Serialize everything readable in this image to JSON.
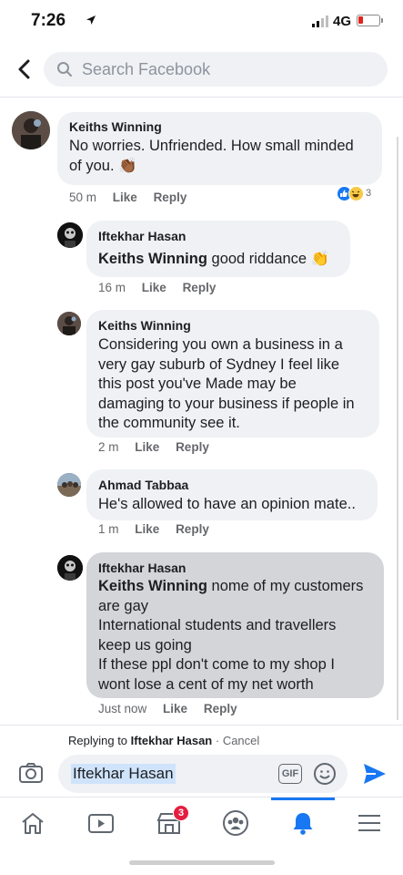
{
  "status_bar": {
    "time": "7:26",
    "network": "4G"
  },
  "search": {
    "placeholder": "Search Facebook"
  },
  "comments": [
    {
      "author": "Keiths Winning",
      "text_lines": [
        "No worries. Unfriended. How small minded",
        "of you. 👏🏾"
      ],
      "time": "50 m",
      "like": "Like",
      "reply": "Reply",
      "reaction_count": "3"
    },
    {
      "author": "Iftekhar Hasan",
      "mention": "Keiths Winning",
      "text_lines": [
        " good riddance 👏"
      ],
      "time": "16 m",
      "like": "Like",
      "reply": "Reply"
    },
    {
      "author": "Keiths Winning",
      "text_lines": [
        "Considering you own a business in a",
        "very gay suburb of Sydney I feel like",
        "this post you've Made may be",
        "damaging to your business if people in",
        "the community see it."
      ],
      "time": "2 m",
      "like": "Like",
      "reply": "Reply"
    },
    {
      "author": "Ahmad Tabbaa",
      "text_lines": [
        "He's allowed to have an opinion mate.."
      ],
      "time": "1 m",
      "like": "Like",
      "reply": "Reply"
    },
    {
      "author": "Iftekhar Hasan",
      "mention": "Keiths Winning",
      "text_lines": [
        " nome of my customers",
        "are gay",
        "International students and travellers",
        "keep us going",
        "If these ppl don't come to my shop I",
        "wont lose a cent of my net worth"
      ],
      "time": "Just now",
      "like": "Like",
      "reply": "Reply"
    }
  ],
  "reply_bar": {
    "prefix": "Replying to ",
    "name": "Iftekhar Hasan",
    "separator": " · ",
    "cancel": "Cancel"
  },
  "composer": {
    "value": "Iftekhar Hasan",
    "gif_label": "GIF"
  },
  "bottom_nav": {
    "marketplace_badge": "3"
  },
  "colors": {
    "accent": "#1877f2",
    "badge": "#e41e3f",
    "bubble": "#eff1f4",
    "bubble_highlight": "#d3d5d9"
  }
}
